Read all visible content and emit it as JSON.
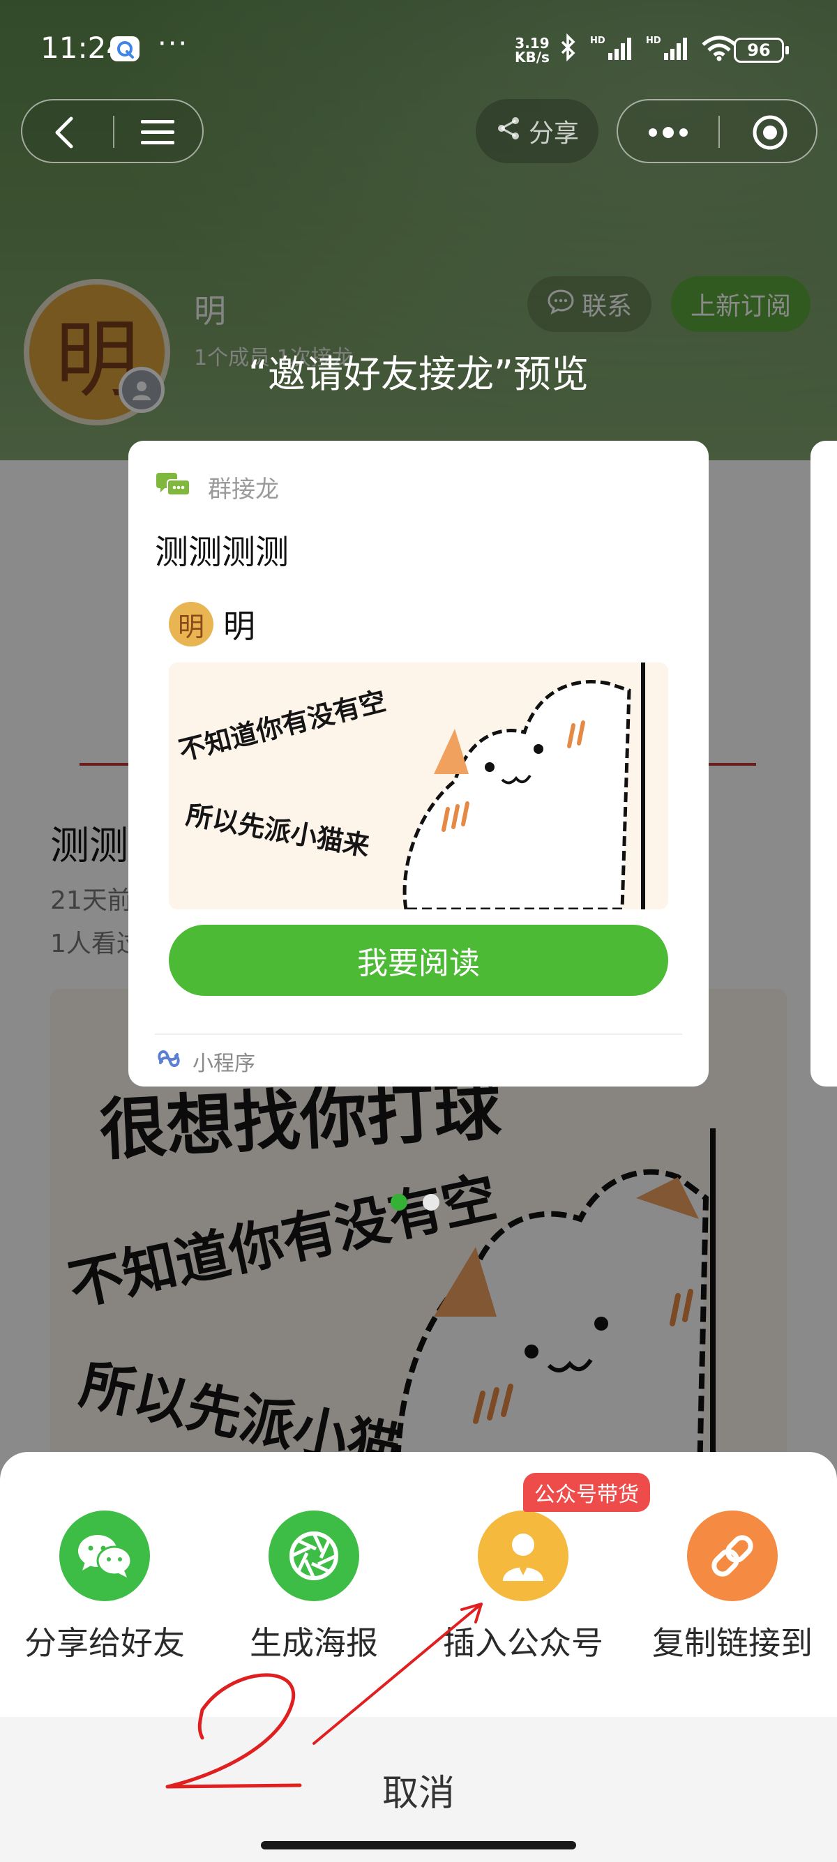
{
  "status_bar": {
    "time": "11:24",
    "more": "···",
    "net_speed_value": "3.19",
    "net_speed_unit": "KB/s",
    "battery": "96"
  },
  "nav": {
    "share_label": "分享"
  },
  "profile": {
    "avatar_char": "明",
    "name": "明",
    "subtitle": "1个成员 1次接龙",
    "contact_label": "联系",
    "subscribe_label": "上新订阅"
  },
  "article": {
    "title": "测测",
    "meta_time": "21天前",
    "meta_views": "1人看过"
  },
  "preview": {
    "heading": "“邀请好友接龙”预览",
    "source": "群接龙",
    "title": "测测测测",
    "author_avatar_char": "明",
    "author_name": "明",
    "read_button": "我要阅读",
    "footer": "小程序",
    "page_count": 2,
    "active_page": 1
  },
  "meme": {
    "line1": "很想找你打球",
    "line2": "不知道你有没有空",
    "line3": "所以先派小猫来"
  },
  "share_sheet": {
    "actions": [
      {
        "label": "分享给好友",
        "icon": "wechat-icon",
        "color": "#3dbd45"
      },
      {
        "label": "生成海报",
        "icon": "aperture-icon",
        "color": "#3dbd45"
      },
      {
        "label": "插入公众号",
        "icon": "official-account-icon",
        "color": "#f4b93d",
        "badge": "公众号带货"
      },
      {
        "label": "复制链接到",
        "icon": "link-icon",
        "color": "#f58a42"
      }
    ],
    "cancel_label": "取消"
  },
  "colors": {
    "brand_green": "#4dba36",
    "badge_red": "#ee4b4b",
    "annotation_red": "#e02020"
  }
}
